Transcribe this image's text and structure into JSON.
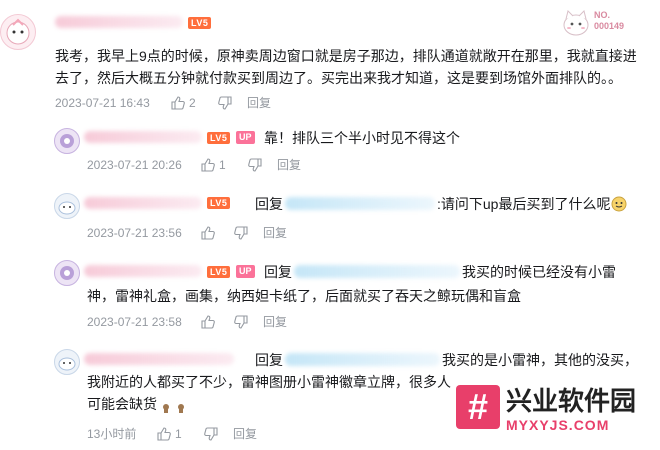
{
  "top_comment": {
    "level": "LV5",
    "badge_no": "NO.",
    "badge_num": "000149",
    "text_line1": "我考，我早上9点的时候，原神卖周边窗口就是房子那边，排队通道就敞开在那里，我就直接进",
    "text_line2": "去了，然后大概五分钟就付款买到周边了。买完出来我才知道，这是要到场馆外面排队的。。",
    "time": "2023-07-21 16:43",
    "likes": "2",
    "reply": "回复"
  },
  "replies": [
    {
      "level": "LV5",
      "up_badge": "UP",
      "text": "靠！排队三个半小时见不得这个",
      "time": "2023-07-21 20:26",
      "likes": "1",
      "reply": "回复"
    },
    {
      "level": "LV5",
      "reply_prefix": "回复",
      "text": ":请问下up最后买到了什么呢",
      "time": "2023-07-21 23:56",
      "reply": "回复"
    },
    {
      "level": "LV5",
      "up_badge": "UP",
      "reply_prefix": "回复",
      "text_line1": "我买的时候已经没有小雷",
      "text_line2": "神，雷神礼盒，画集，纳西妲卡纸了，后面就买了吞天之鲸玩偶和盲盒",
      "time": "2023-07-21 23:58",
      "reply": "回复"
    },
    {
      "reply_prefix": "回复",
      "text_line1": "我买的是小雷神，其他的没买，",
      "text_line2": "我附近的人都买了不少，雷神图册小雷神徽章立牌，很多人",
      "text_line3": "可能会缺货",
      "time": "13小时前",
      "likes": "1",
      "reply": "回复"
    }
  ],
  "watermark": {
    "mark": "#",
    "title": "兴业软件园",
    "url": "MYXYJS.COM"
  },
  "colors": {
    "level_badge": "#ff6e3c",
    "up_badge": "#fb7299",
    "meta_text": "#9499a0",
    "watermark_accent": "#e83f6a"
  }
}
